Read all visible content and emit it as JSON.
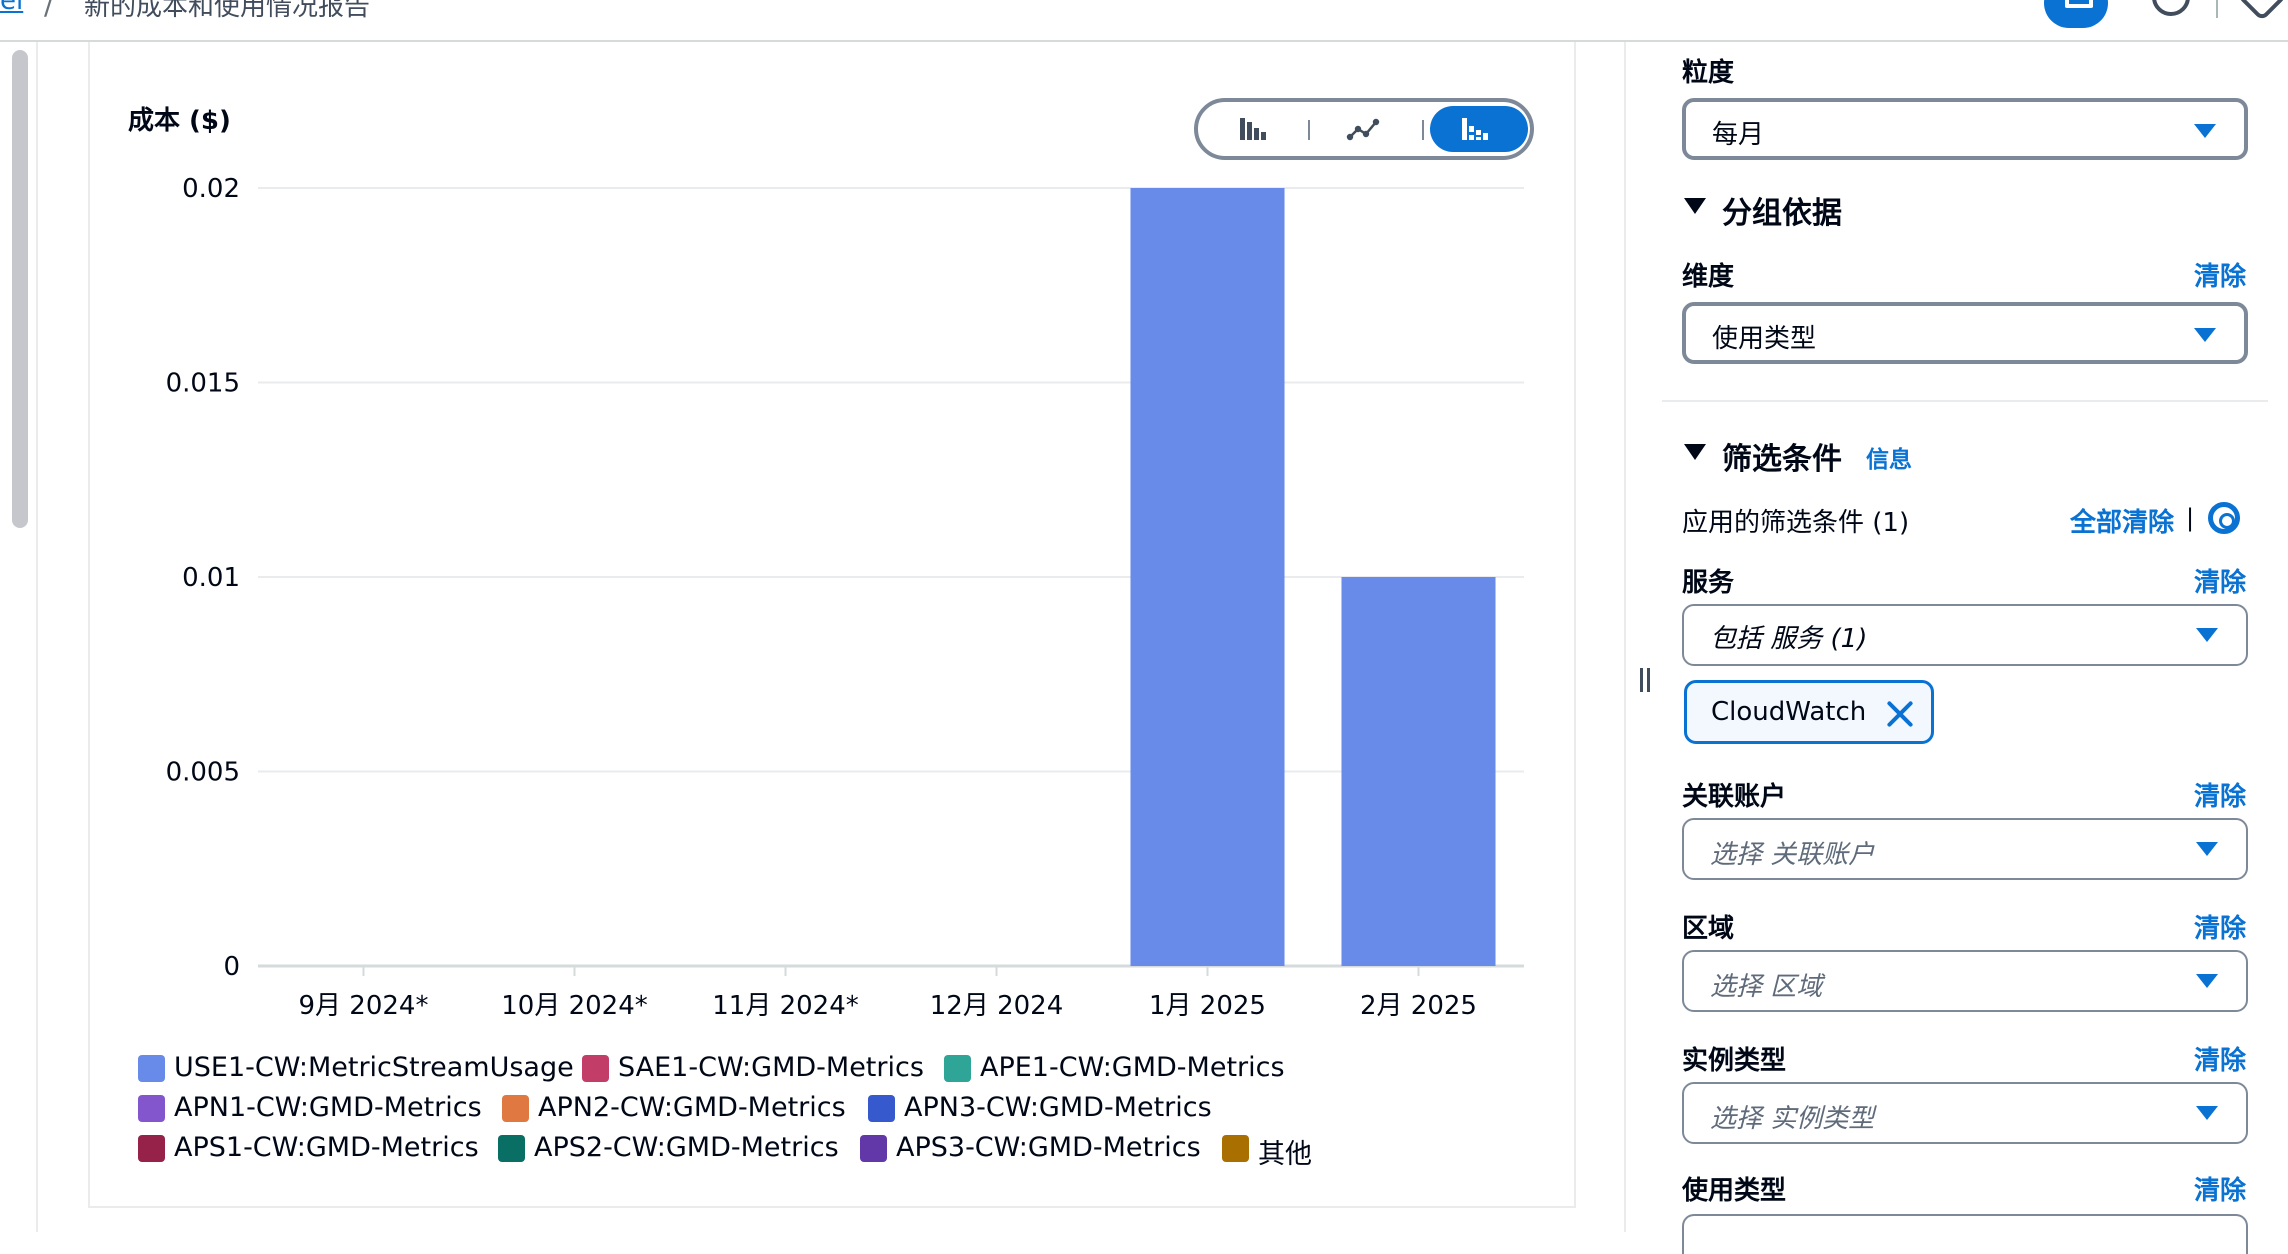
{
  "breadcrumb": {
    "link": "el",
    "separator": "/",
    "current": "新的成本和使用情况报告"
  },
  "chart_panel": {
    "title": "成本 ($)",
    "chart_type_options": [
      "bar-chart-icon",
      "line-chart-icon",
      "stacked-bar-chart-icon"
    ],
    "selected_chart_type": "stacked-bar-chart-icon"
  },
  "chart_data": {
    "type": "bar",
    "stacked": true,
    "title": "",
    "ylabel": "成本 ($)",
    "xlabel": "",
    "categories": [
      "9月 2024*",
      "10月 2024*",
      "11月 2024*",
      "12月 2024",
      "1月 2025",
      "2月 2025"
    ],
    "ylim": [
      0,
      0.02
    ],
    "yticks": [
      "0",
      "0.005",
      "0.01",
      "0.015",
      "0.02"
    ],
    "ytick_values": [
      0,
      0.005,
      0.01,
      0.015,
      0.02
    ],
    "grid": true,
    "series": [
      {
        "name": "USE1-CW:MetricStreamUsage",
        "color": "#688ae8",
        "values": [
          0,
          0,
          0,
          0,
          0.02,
          0.01
        ]
      },
      {
        "name": "SAE1-CW:GMD-Metrics",
        "color": "#c33d69",
        "values": [
          0,
          0,
          0,
          0,
          0,
          0
        ]
      },
      {
        "name": "APE1-CW:GMD-Metrics",
        "color": "#2ea597",
        "values": [
          0,
          0,
          0,
          0,
          0,
          0
        ]
      },
      {
        "name": "APN1-CW:GMD-Metrics",
        "color": "#8456ce",
        "values": [
          0,
          0,
          0,
          0,
          0,
          0
        ]
      },
      {
        "name": "APN2-CW:GMD-Metrics",
        "color": "#e07941",
        "values": [
          0,
          0,
          0,
          0,
          0,
          0
        ]
      },
      {
        "name": "APN3-CW:GMD-Metrics",
        "color": "#3759ce",
        "values": [
          0,
          0,
          0,
          0,
          0,
          0
        ]
      },
      {
        "name": "APS1-CW:GMD-Metrics",
        "color": "#962249",
        "values": [
          0,
          0,
          0,
          0,
          0,
          0
        ]
      },
      {
        "name": "APS2-CW:GMD-Metrics",
        "color": "#096f64",
        "values": [
          0,
          0,
          0,
          0,
          0,
          0
        ]
      },
      {
        "name": "APS3-CW:GMD-Metrics",
        "color": "#6237a7",
        "values": [
          0,
          0,
          0,
          0,
          0,
          0
        ]
      },
      {
        "name": "其他",
        "color": "#a96f00",
        "values": [
          0,
          0,
          0,
          0,
          0,
          0
        ]
      }
    ],
    "legend_position": "bottom"
  },
  "settings": {
    "granularity": {
      "label": "粒度",
      "value": "每月"
    },
    "group_by": {
      "title": "分组依据",
      "dimension_label": "维度",
      "dimension_clear": "清除",
      "dimension_value": "使用类型"
    },
    "filters": {
      "title": "筛选条件",
      "info": "信息",
      "applied": "应用的筛选条件 (1)",
      "clear_all": "全部清除",
      "separator": "|",
      "service": {
        "label": "服务",
        "clear": "清除",
        "value": "包括 服务 (1)",
        "token": "CloudWatch"
      },
      "linked_account": {
        "label": "关联账户",
        "clear": "清除",
        "placeholder": "选择 关联账户"
      },
      "region": {
        "label": "区域",
        "clear": "清除",
        "placeholder": "选择 区域"
      },
      "instance_type": {
        "label": "实例类型",
        "clear": "清除",
        "placeholder": "选择 实例类型"
      },
      "usage_type": {
        "label": "使用类型",
        "clear": "清除"
      }
    }
  },
  "colors": {
    "accent": "#0972d3",
    "bar": "#688ae8",
    "grid": "#e9ebed",
    "axis": "#d5dbdb"
  }
}
